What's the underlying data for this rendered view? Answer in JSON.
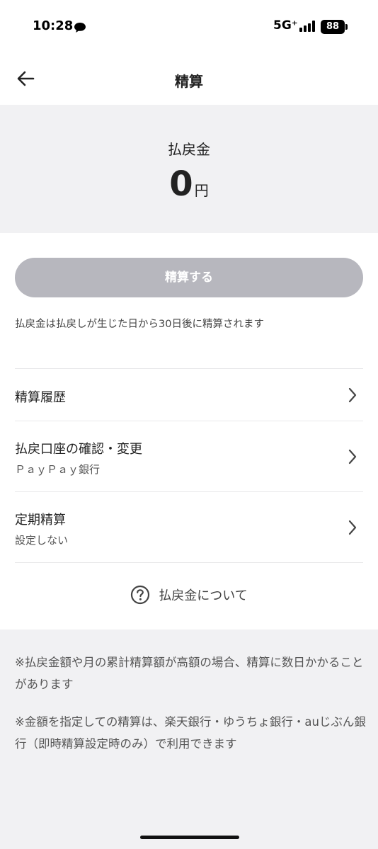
{
  "status_bar": {
    "time": "10:28",
    "network": "5G⁺",
    "battery": "88"
  },
  "header": {
    "title": "精算",
    "back_icon": "arrow-left-icon"
  },
  "balance": {
    "label": "払戻金",
    "amount": "0",
    "unit": "円"
  },
  "actions": {
    "settle_label": "精算する",
    "settle_enabled": false,
    "settle_note": "払戻金は払戻しが生じた日から30日後に精算されます"
  },
  "menu": [
    {
      "title": "精算履歴",
      "subtitle": ""
    },
    {
      "title": "払戻口座の確認・変更",
      "subtitle": "ＰａｙＰａｙ銀行"
    },
    {
      "title": "定期精算",
      "subtitle": "設定しない"
    }
  ],
  "about": {
    "label": "払戻金について",
    "icon": "question-circle-icon"
  },
  "notes": [
    "※払戻金額や月の累計精算額が高額の場合、精算に数日かかることがあります",
    "※金額を指定しての精算は、楽天銀行・ゆうちょ銀行・auじぶん銀行（即時精算設定時のみ）で利用できます"
  ],
  "colors": {
    "section_bg": "#f1f1f3",
    "button_disabled": "#b7b7be",
    "divider": "#e8e8ea"
  }
}
